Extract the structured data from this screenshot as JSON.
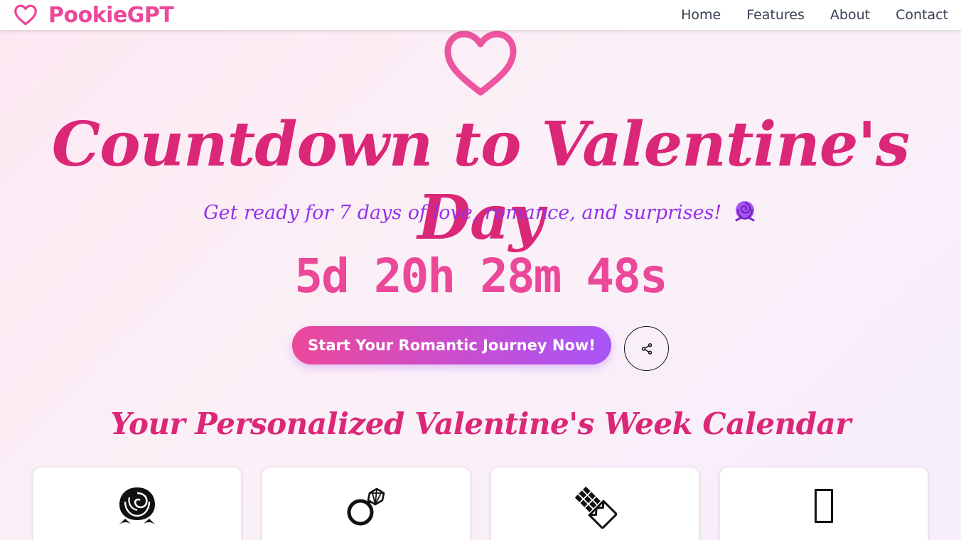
{
  "brand": {
    "name": "PookieGPT",
    "color": "#ec4899"
  },
  "nav": {
    "items": [
      "Home",
      "Features",
      "About",
      "Contact"
    ]
  },
  "hero": {
    "title": "Countdown to Valentine's Day",
    "subtitle": "Get ready for 7 days of love, romance, and surprises!",
    "subtitle_emoji": "rose",
    "countdown": {
      "days": "5d",
      "hours": "20h",
      "minutes": "28m",
      "seconds": "48s"
    },
    "cta_label": "Start Your Romantic Journey Now!",
    "share_icon": "share-icon"
  },
  "calendar": {
    "title": "Your Personalized Valentine's Week Calendar",
    "cards": [
      {
        "icon": "rose-icon",
        "label": ""
      },
      {
        "icon": "ring-icon",
        "label": ""
      },
      {
        "icon": "chocolate-icon",
        "label": ""
      },
      {
        "icon": "missing-glyph-icon",
        "label": ""
      }
    ]
  },
  "colors": {
    "primary_pink": "#ec4899",
    "title_pink": "#db2777",
    "subtitle_purple": "#9333ea",
    "gradient_end": "#a855f7"
  }
}
